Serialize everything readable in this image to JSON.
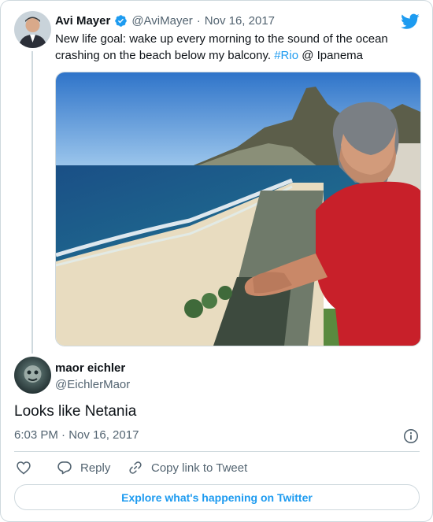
{
  "original_tweet": {
    "display_name": "Avi Mayer",
    "handle": "@AviMayer",
    "date_separator": "·",
    "date": "Nov 16, 2017",
    "text_before": "New life goal: wake up every morning to the sound of the ocean crashing on the beach below my balcony. ",
    "hashtag": "#Rio",
    "text_after": " @ Ipanema"
  },
  "reply": {
    "display_name": "maor eichler",
    "handle": "@EichlerMaor",
    "text": "Looks like Netania",
    "timestamp": "6:03 PM · Nov 16, 2017"
  },
  "actions": {
    "reply_label": "Reply",
    "copy_link_label": "Copy link to Tweet"
  },
  "footer": {
    "explore_label": "Explore what's happening on Twitter"
  },
  "icons": {
    "twitter_logo": "twitter-bird-icon",
    "verified": "verified-badge-icon",
    "info": "info-icon",
    "like": "heart-icon",
    "reply": "reply-bubble-icon",
    "copy_link": "link-icon"
  },
  "colors": {
    "accent": "#1d9bf0",
    "text": "#0f1419",
    "muted": "#536471",
    "border": "#cfd9de"
  }
}
